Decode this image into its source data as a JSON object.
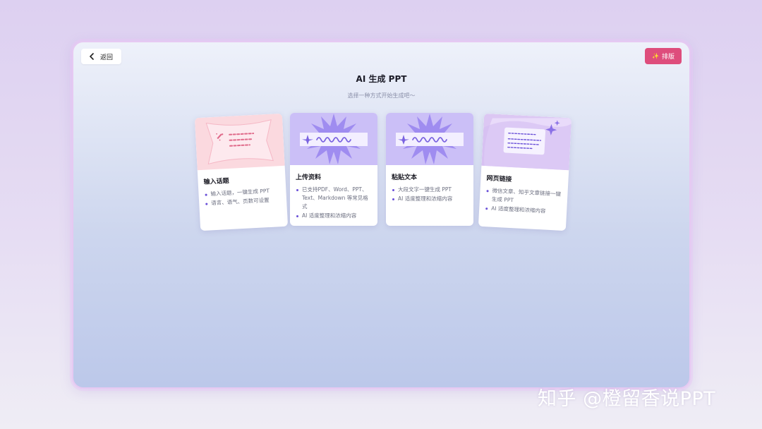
{
  "header": {
    "back_label": "返回",
    "layout_label": "排版",
    "title": "AI 生成 PPT",
    "subtitle": "选择一种方式开始生成吧～"
  },
  "cards": [
    {
      "title": "输入话题",
      "items": [
        "输入话题，一键生成 PPT",
        "语言、语气、页数可设置"
      ]
    },
    {
      "title": "上传资料",
      "items": [
        "已支持PDF、Word、PPT、Text、Markdown 等常见格式",
        "AI 适度整理和浓缩内容"
      ]
    },
    {
      "title": "粘贴文本",
      "items": [
        "大段文字一键生成 PPT",
        "AI 适度整理和浓缩内容"
      ]
    },
    {
      "title": "网页链接",
      "items": [
        "微信文章、知乎文章链接一键生成 PPT",
        "AI 适度整理和浓缩内容"
      ]
    }
  ],
  "watermark": "知乎 @橙留香说PPT",
  "icons": {
    "back": "chevron-left-icon",
    "layout": "sparkle-icon"
  },
  "colors": {
    "accent": "#de4d7c",
    "bullet": "#6a50d8",
    "card1_illus": "#fbd9df",
    "card2_illus": "#cbbff7",
    "card4_illus": "#dcc7f3"
  }
}
